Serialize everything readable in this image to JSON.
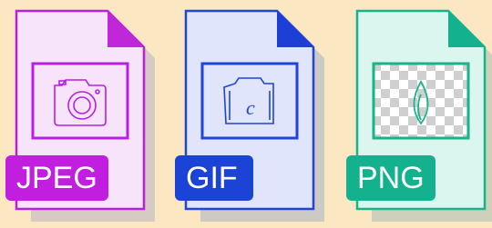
{
  "files": [
    {
      "label": "JPEG",
      "icon": "camera-icon",
      "colors": {
        "fill": "#f7e4fb",
        "stroke": "#b81fe0",
        "fold": "#c027d9",
        "badge": "#c21ee0"
      }
    },
    {
      "label": "GIF",
      "icon": "camera-gif-icon",
      "colors": {
        "fill": "#e1e5fb",
        "stroke": "#1e45d8",
        "fold": "#1d3fd6",
        "badge": "#1b44d6"
      }
    },
    {
      "label": "PNG",
      "icon": "transparent-leaf-icon",
      "colors": {
        "fill": "#dbf6ef",
        "stroke": "#17b48c",
        "fold": "#13b18d",
        "badge": "#13b18d"
      }
    }
  ]
}
